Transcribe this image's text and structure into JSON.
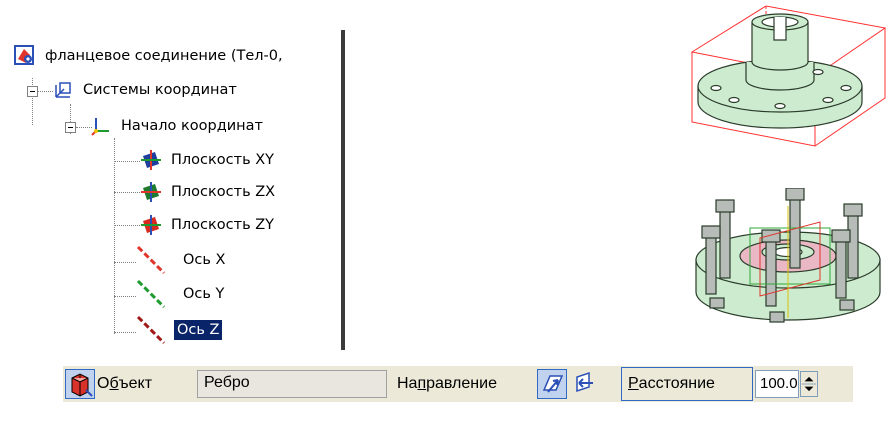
{
  "tree": {
    "root": {
      "label": "фланцевое соединение  (Тел-0,"
    },
    "coord_systems": {
      "label": "Системы координат"
    },
    "origin": {
      "label": "Начало координат"
    },
    "items": [
      {
        "label": "Плоскость XY",
        "icon": "plane-xy-icon"
      },
      {
        "label": "Плоскость ZX",
        "icon": "plane-zx-icon"
      },
      {
        "label": "Плоскость ZY",
        "icon": "plane-zy-icon"
      },
      {
        "label": "Ось X",
        "icon": "axis-x-icon"
      },
      {
        "label": "Ось Y",
        "icon": "axis-y-icon"
      },
      {
        "label": "Ось Z",
        "icon": "axis-z-icon",
        "selected": true
      }
    ]
  },
  "toolbar": {
    "object": {
      "label_pre": "О",
      "label_hot": "б",
      "label_post": "ъект",
      "value": "Ребро"
    },
    "direction": {
      "label_pre": "На",
      "label_hot": "п",
      "label_post": "равление"
    },
    "distance": {
      "label_pre": "",
      "label_hot": "Р",
      "label_post": "асстояние",
      "value": "100.0"
    }
  },
  "colors": {
    "selection": "#0a246a",
    "model_fill": "#cdebcf",
    "bbox": "#ff3030",
    "toolbar_bg": "#ece9d8"
  }
}
